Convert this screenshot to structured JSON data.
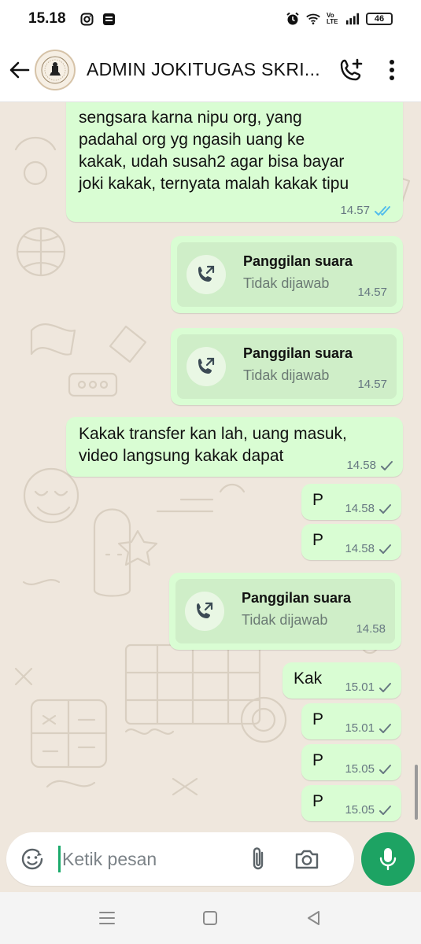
{
  "status_bar": {
    "time": "15.18",
    "battery": "46",
    "network_label": "Vo LTE"
  },
  "header": {
    "contact_name": "ADMIN JOKITUGAS SKRI..."
  },
  "messages": [
    {
      "type": "text",
      "lines": [
        "sengsara karna nipu org, yang",
        "padahal org yg ngasih uang ke",
        "kakak, udah susah2 agar bisa bayar",
        "joki kakak, ternyata malah kakak tipu"
      ],
      "time": "14.57",
      "status": "read"
    },
    {
      "type": "call",
      "title": "Panggilan suara",
      "subtitle": "Tidak dijawab",
      "time": "14.57"
    },
    {
      "type": "call",
      "title": "Panggilan suara",
      "subtitle": "Tidak dijawab",
      "time": "14.57"
    },
    {
      "type": "text",
      "lines": [
        "Kakak transfer kan lah, uang masuk,",
        "video langsung kakak dapat"
      ],
      "time": "14.58",
      "status": "sent"
    },
    {
      "type": "text",
      "lines": [
        "P"
      ],
      "time": "14.58",
      "status": "sent"
    },
    {
      "type": "text",
      "lines": [
        "P"
      ],
      "time": "14.58",
      "status": "sent"
    },
    {
      "type": "call",
      "title": "Panggilan suara",
      "subtitle": "Tidak dijawab",
      "time": "14.58"
    },
    {
      "type": "text",
      "lines": [
        "Kak"
      ],
      "time": "15.01",
      "status": "sent"
    },
    {
      "type": "text",
      "lines": [
        "P"
      ],
      "time": "15.01",
      "status": "sent"
    },
    {
      "type": "text",
      "lines": [
        "P"
      ],
      "time": "15.05",
      "status": "sent"
    },
    {
      "type": "text",
      "lines": [
        "P"
      ],
      "time": "15.05",
      "status": "sent"
    }
  ],
  "composer": {
    "placeholder": "Ketik pesan"
  },
  "colors": {
    "bubble": "#d9fdd3",
    "call_card": "#cfeec8",
    "accent": "#1da363",
    "read_tick": "#53bdeb",
    "wallpaper": "#efe7dd"
  }
}
